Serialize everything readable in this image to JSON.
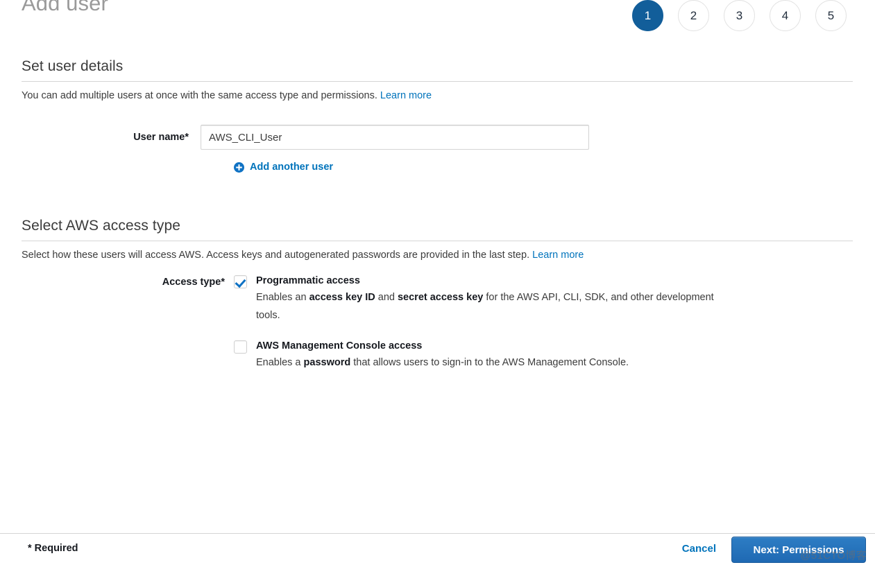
{
  "header": {
    "title": "Add user",
    "steps": [
      {
        "label": "1",
        "active": true
      },
      {
        "label": "2",
        "active": false
      },
      {
        "label": "3",
        "active": false
      },
      {
        "label": "4",
        "active": false
      },
      {
        "label": "5",
        "active": false
      }
    ]
  },
  "user_details": {
    "section_title": "Set user details",
    "description": "You can add multiple users at once with the same access type and permissions.",
    "learn_more": "Learn more",
    "user_name_label": "User name*",
    "user_name_value": "AWS_CLI_User",
    "user_name_placeholder": "",
    "add_another_label": "Add another user",
    "add_another_icon": "plus-circle-icon"
  },
  "access_type": {
    "section_title": "Select AWS access type",
    "description": "Select how these users will access AWS. Access keys and autogenerated passwords are provided in the last step.",
    "learn_more": "Learn more",
    "access_type_label": "Access type*",
    "options": [
      {
        "title": "Programmatic access",
        "checked": true,
        "desc_part1": "Enables an ",
        "desc_bold1": "access key ID",
        "desc_part2": " and ",
        "desc_bold2": "secret access key",
        "desc_part3": " for the AWS API, CLI, SDK, and other development tools."
      },
      {
        "title": "AWS Management Console access",
        "checked": false,
        "desc_part1": "Enables a ",
        "desc_bold1": "password",
        "desc_part2": " that allows users to sign-in to the AWS Management Console.",
        "desc_bold2": "",
        "desc_part3": ""
      }
    ]
  },
  "footer": {
    "required_label": "* Required",
    "cancel_label": "Cancel",
    "next_label": "Next: Permissions"
  },
  "watermark": {
    "text": "@51CTO博客"
  },
  "colors": {
    "accent_blue": "#0073bb",
    "step_active": "#125e9a",
    "button_blue": "#2d7dc4",
    "text_dark": "#16191f",
    "text_body": "#3b3b3b",
    "title_gray": "#9a9a9a",
    "rule_gray": "#d5d5d5"
  }
}
